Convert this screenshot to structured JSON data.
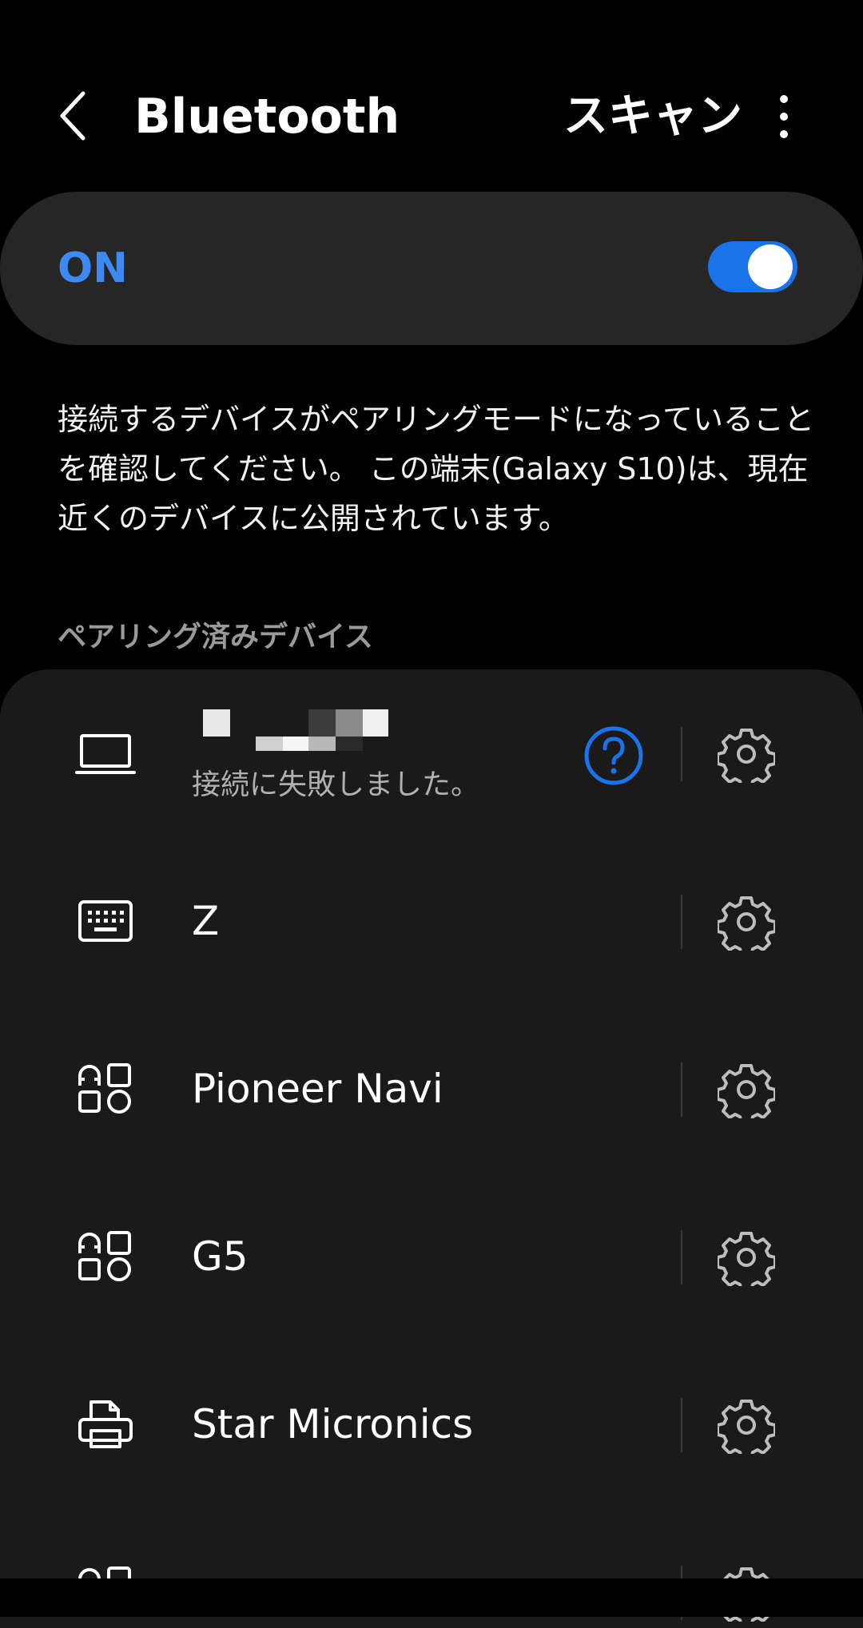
{
  "header": {
    "title": "Bluetooth",
    "scan_label": "スキャン"
  },
  "toggle": {
    "label": "ON",
    "state": "on",
    "accent_color": "#1a73e8"
  },
  "description": "接続するデバイスがペアリングモードになっていることを確認してください。 この端末(Galaxy S10)は、現在近くのデバイスに公開されています。",
  "paired_section": {
    "header": "ペアリング済みデバイス",
    "devices": [
      {
        "icon": "laptop-icon",
        "name": "",
        "name_redacted": true,
        "status": "接続に失敗しました。",
        "has_help": true
      },
      {
        "icon": "keyboard-icon",
        "name": "Z"
      },
      {
        "icon": "device-generic-icon",
        "name": "Pioneer Navi"
      },
      {
        "icon": "device-generic-icon",
        "name": "G5"
      },
      {
        "icon": "printer-icon",
        "name": "Star Micronics"
      },
      {
        "icon": "device-generic-icon",
        "name": ""
      }
    ]
  }
}
